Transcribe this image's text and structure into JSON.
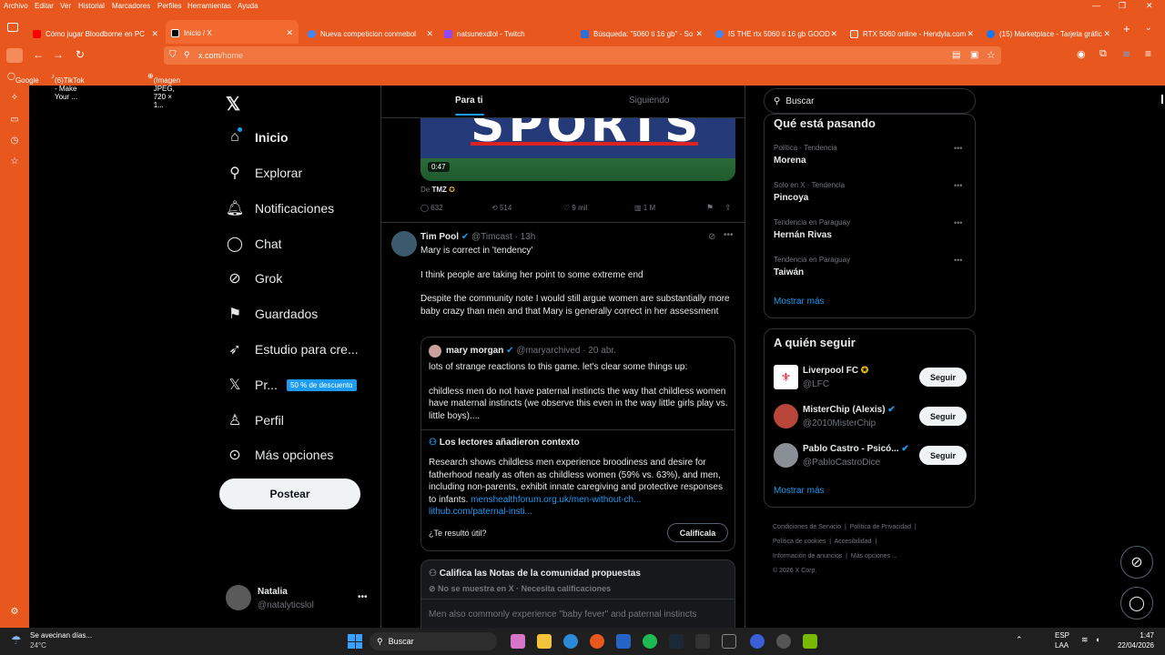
{
  "menubar": {
    "items": [
      "Archivo",
      "Editar",
      "Ver",
      "Historial",
      "Marcadores",
      "Perfiles",
      "Herramientas",
      "Ayuda"
    ]
  },
  "tabs": [
    {
      "label": "Cómo jugar Bloodborne en PC",
      "color": "#ff0000"
    },
    {
      "label": "Inicio / X",
      "color": "#000000"
    },
    {
      "label": "Nueva competicion conmebol",
      "color": "#4285f4"
    },
    {
      "label": "natsunexdlol - Twitch",
      "color": "#9146ff"
    },
    {
      "label": "Búsqueda: \"5060 ti 16 gb\" - So",
      "color": "#2f6fd6"
    },
    {
      "label": "IS THE rtx 5060 ti 16 gb GOOD",
      "color": "#4285f4"
    },
    {
      "label": "RTX 5060 online - Hendyla.com",
      "color": "#e86a2a"
    },
    {
      "label": "(15) Marketplace - Tarjeta gráfic",
      "color": "#1877f2"
    }
  ],
  "url": {
    "host": "x.com",
    "path": "/home"
  },
  "bookmarks": [
    "Google",
    "(6)TikTok - Make Your ...",
    "(Imagen JPEG, 720 × 1..."
  ],
  "nav": {
    "items": [
      "Inicio",
      "Explorar",
      "Notificaciones",
      "Chat",
      "Grok",
      "Guardados",
      "Estudio para cre...",
      "Pr...",
      "Perfil",
      "Más opciones"
    ],
    "premium_badge": "50 % de descuento",
    "post_label": "Postear",
    "user_name": "Natalia",
    "user_handle": "@natalyticslol"
  },
  "timeline": {
    "tab_foryou": "Para ti",
    "tab_following": "Siguiendo",
    "video_banner": "SPORTS",
    "video_time": "0:47",
    "source_prefix": "De",
    "source_name": "TMZ",
    "stats": {
      "replies": "632",
      "reposts": "514",
      "likes": "9 mil",
      "views": "1 M"
    },
    "tweet": {
      "name": "Tim Pool",
      "handle": "@Timcast",
      "time": "· 13h",
      "line1": "Mary is correct in 'tendency'",
      "line2": "I think people are taking her point to some extreme end",
      "line3": "Despite the community note I would still argue women are substantially more baby crazy than men and that Mary is generally correct in her assessment"
    },
    "quote": {
      "name": "mary morgan",
      "handle": "@maryarchived",
      "time": "· 20 abr.",
      "line1": "lots of strange reactions to this game. let's clear some things up:",
      "line2": "childless men do not have paternal instincts the way that childless women have maternal instincts (we observe this even in the way little girls play vs. little boys)...."
    },
    "context": {
      "title": "Los lectores añadieron contexto",
      "body": "Research shows childless men experience broodiness and desire for fatherhood nearly as often as childless women (59% vs. 63%), and men, including non-parents, exhibit innate caregiving and protective responses to infants.",
      "link1": "menshealthforum.org.uk/men-without-ch...",
      "link2": "lithub.com/paternal-insti...",
      "question": "¿Te resultó útil?",
      "rate_label": "Califícala"
    },
    "notes": {
      "title": "Califica las Notas de la comunidad propuestas",
      "status": "No se muestra en X · Necesita calificaciones",
      "preview": "Men also commonly experience \"baby fever\" and paternal instincts"
    }
  },
  "search": {
    "placeholder": "Buscar"
  },
  "trends": {
    "title": "Qué está pasando",
    "items": [
      {
        "cat": "Política · Tendencia",
        "name": "Morena"
      },
      {
        "cat": "Solo en X · Tendencia",
        "name": "Pincoya"
      },
      {
        "cat": "Tendencia en Paraguay",
        "name": "Hernán Rivas"
      },
      {
        "cat": "Tendencia en Paraguay",
        "name": "Taiwán"
      }
    ],
    "more": "Mostrar más"
  },
  "who_to_follow": {
    "title": "A quién seguir",
    "items": [
      {
        "name": "Liverpool FC",
        "handle": "@LFC",
        "badge": "#e2b719"
      },
      {
        "name": "MisterChip (Alexis)",
        "handle": "@2010MisterChip",
        "badge": "#1d9bf0"
      },
      {
        "name": "Pablo Castro - Psicó...",
        "handle": "@PabloCastroDice",
        "badge": "#1d9bf0"
      }
    ],
    "follow_label": "Seguir",
    "more": "Mostrar más"
  },
  "footer": {
    "links": [
      "Condiciones de Servicio",
      "Política de Privacidad",
      "Política de cookies",
      "Accesibilidad",
      "Información de anuncios",
      "Más opciones ..."
    ],
    "copyright": "© 2026 X Corp."
  },
  "taskbar": {
    "weather_title": "Se avecinan días...",
    "weather_temp": "24°C",
    "search": "Buscar",
    "lang1": "ESP",
    "lang2": "LAA",
    "time": "1:47",
    "date": "22/04/2026"
  }
}
